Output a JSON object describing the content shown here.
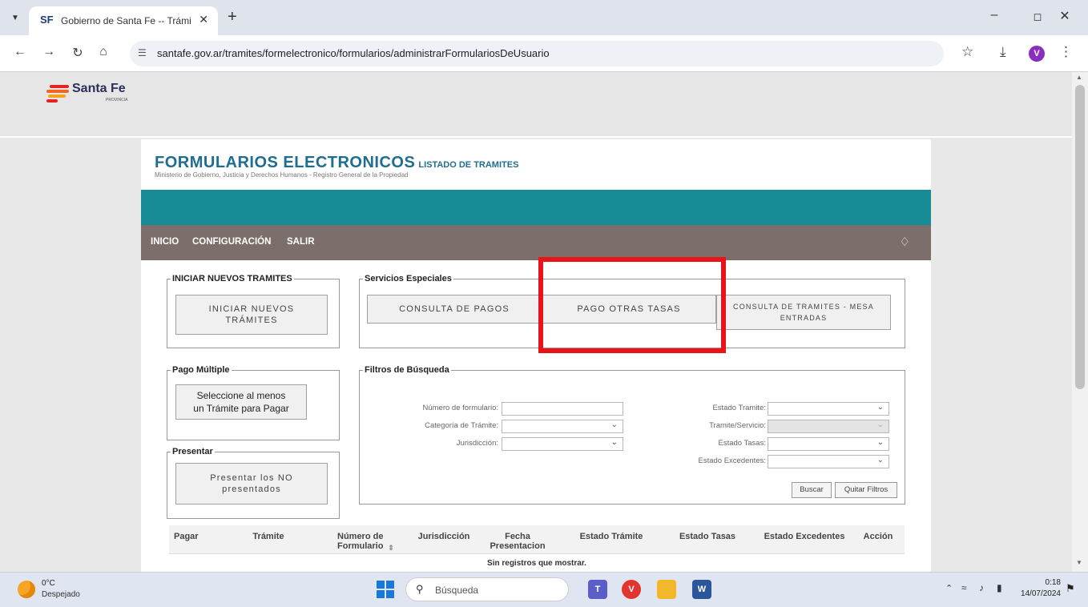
{
  "browser": {
    "tab_title": "Gobierno de Santa Fe -- Trámite",
    "tab_favicon_text": "SF",
    "url": "santafe.gov.ar/tramites/formelectronico/formularios/administrarFormulariosDeUsuario",
    "profile_initial": "V"
  },
  "site": {
    "logo_text": "Santa Fe",
    "logo_sub": "PROVINCIA"
  },
  "page": {
    "title": "FORMULARIOS ELECTRONICOS",
    "title_sub": "LISTADO DE TRAMITES",
    "subtitle": "Ministerio de Gobierno, Justicia y Derechos Humanos - Registro General de la Propiedad",
    "menu": [
      "INICIO",
      "CONFIGURACIÓN",
      "SALIR"
    ]
  },
  "panels": {
    "iniciar": {
      "legend": "INICIAR NUEVOS TRAMITES",
      "button": "INICIAR NUEVOS TRÁMITES"
    },
    "servicios": {
      "legend": "Servicios Especiales",
      "consulta_pagos": "CONSULTA DE PAGOS",
      "pago_otras_tasas": "PAGO OTRAS TASAS",
      "consulta_tramites": "CONSULTA DE TRAMITES - MESA ENTRADAS"
    },
    "pago_multiple": {
      "legend": "Pago Múltiple",
      "button": "Seleccione al menos un Trámite para Pagar"
    },
    "presentar": {
      "legend": "Presentar",
      "button": "Presentar los NO presentados"
    },
    "filtros": {
      "legend": "Filtros de Búsqueda",
      "numero_formulario": "Número de formulario:",
      "categoria_tramite": "Categoría de Trámite:",
      "jurisdiccion": "Jurisdicción:",
      "estado_tramite": "Estado Tramite:",
      "tramite_servicio": "Tramite/Servicio:",
      "estado_tasas": "Estado Tasas:",
      "estado_excedentes": "Estado Excedentes:",
      "buscar": "Buscar",
      "quitar_filtros": "Quitar Filtros"
    }
  },
  "table": {
    "headers": {
      "pagar": "Pagar",
      "tramite": "Trámite",
      "numero_formulario": "Número de Formulario",
      "jurisdiccion": "Jurisdicción",
      "fecha_presentacion": "Fecha Presentacion",
      "estado_tramite": "Estado Trámite",
      "estado_tasas": "Estado Tasas",
      "estado_excedentes": "Estado Excedentes",
      "accion": "Acción"
    },
    "empty_message": "Sin registros que mostrar."
  },
  "taskbar": {
    "temperature": "0°C",
    "weather": "Despejado",
    "search_placeholder": "Búsqueda",
    "time": "0:18",
    "date": "14/07/2024"
  },
  "colors": {
    "teal_bar": "#178b95",
    "menu_bar": "#7c6e6b",
    "title_blue": "#1f6d8f",
    "highlight_red": "#e8141a"
  }
}
